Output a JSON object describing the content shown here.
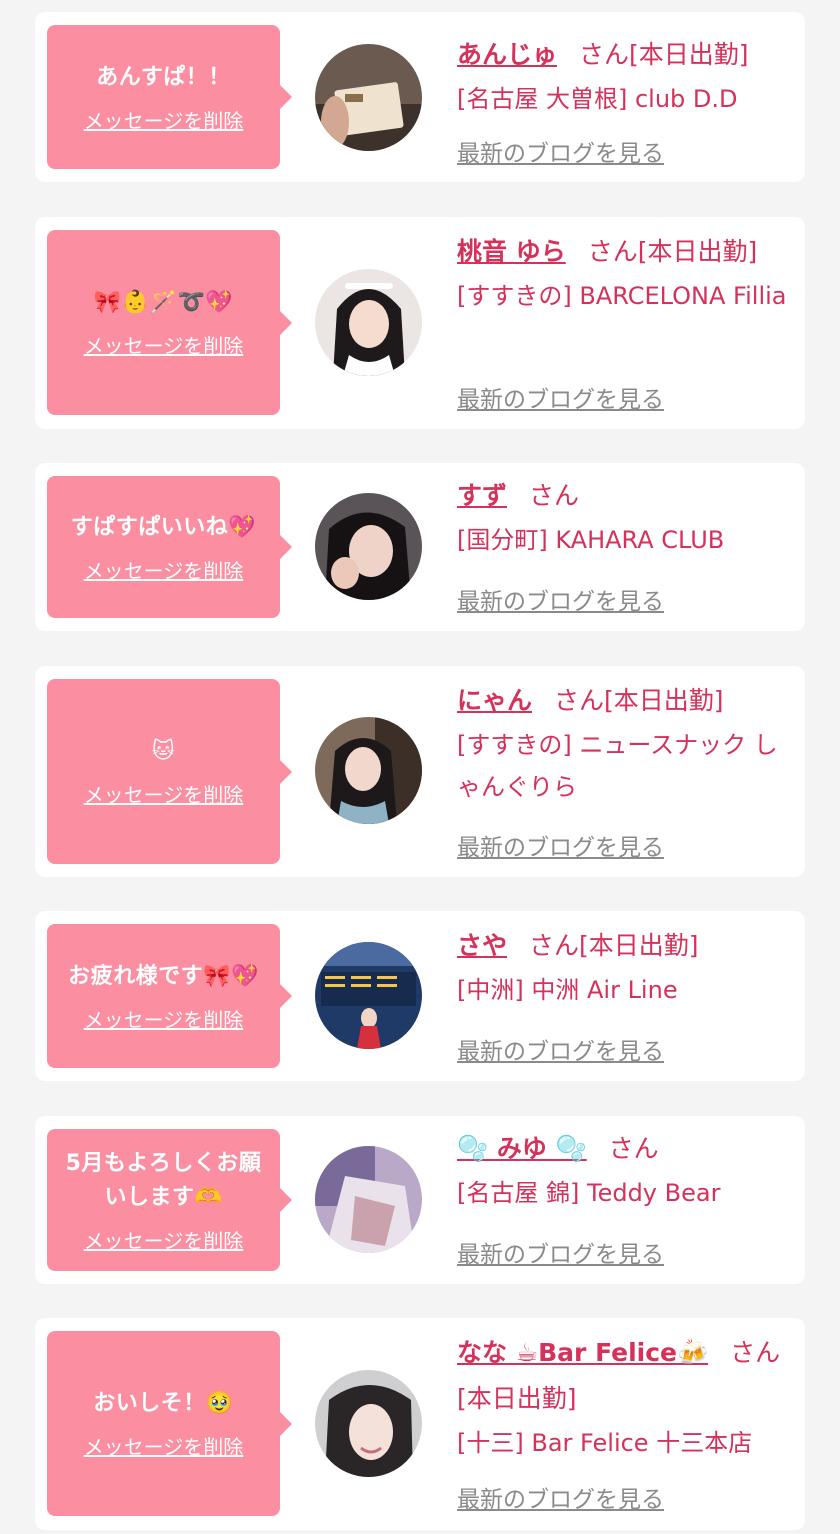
{
  "delete_label": "メッセージを削除",
  "blog_label": "最新のブログを見る",
  "san_label": "さん",
  "cards": [
    {
      "message": "あんすぱ！！",
      "name": "あんじゅ",
      "status": "[本日出勤]",
      "shop": "[名古屋 大曽根] club D.D"
    },
    {
      "message": "🎀👶🪄➰💖",
      "name": "桃音 ゆら",
      "status": "[本日出勤]",
      "shop": "[すすきの] BARCELONA Fillia"
    },
    {
      "message": "すぱすぱいいね💖",
      "name": "すず",
      "status": "",
      "shop": "[国分町] KAHARA CLUB"
    },
    {
      "message": "🐱",
      "name": "にゃん",
      "status": "[本日出勤]",
      "shop": "[すすきの] ニュースナック しゃんぐりら"
    },
    {
      "message": "お疲れ様です🎀💖",
      "name": "さや",
      "status": "[本日出勤]",
      "shop": "[中洲] 中洲 Air Line"
    },
    {
      "message": "5月もよろしくお願いします🫶",
      "name": "🫧 みゆ 🫧",
      "status": "",
      "shop": "[名古屋 錦] Teddy Bear"
    },
    {
      "message": "おいしそ！🥹",
      "name": "なな ☕Bar Felice🍻",
      "status": "[本日出勤]",
      "shop": "[十三] Bar Felice 十三本店"
    }
  ],
  "colors": {
    "bubble": "#fb8ea0",
    "accent": "#d6315a",
    "link_gray": "#8a8a8a",
    "card_bg": "#ffffff",
    "page_bg": "#f4f4f4"
  }
}
